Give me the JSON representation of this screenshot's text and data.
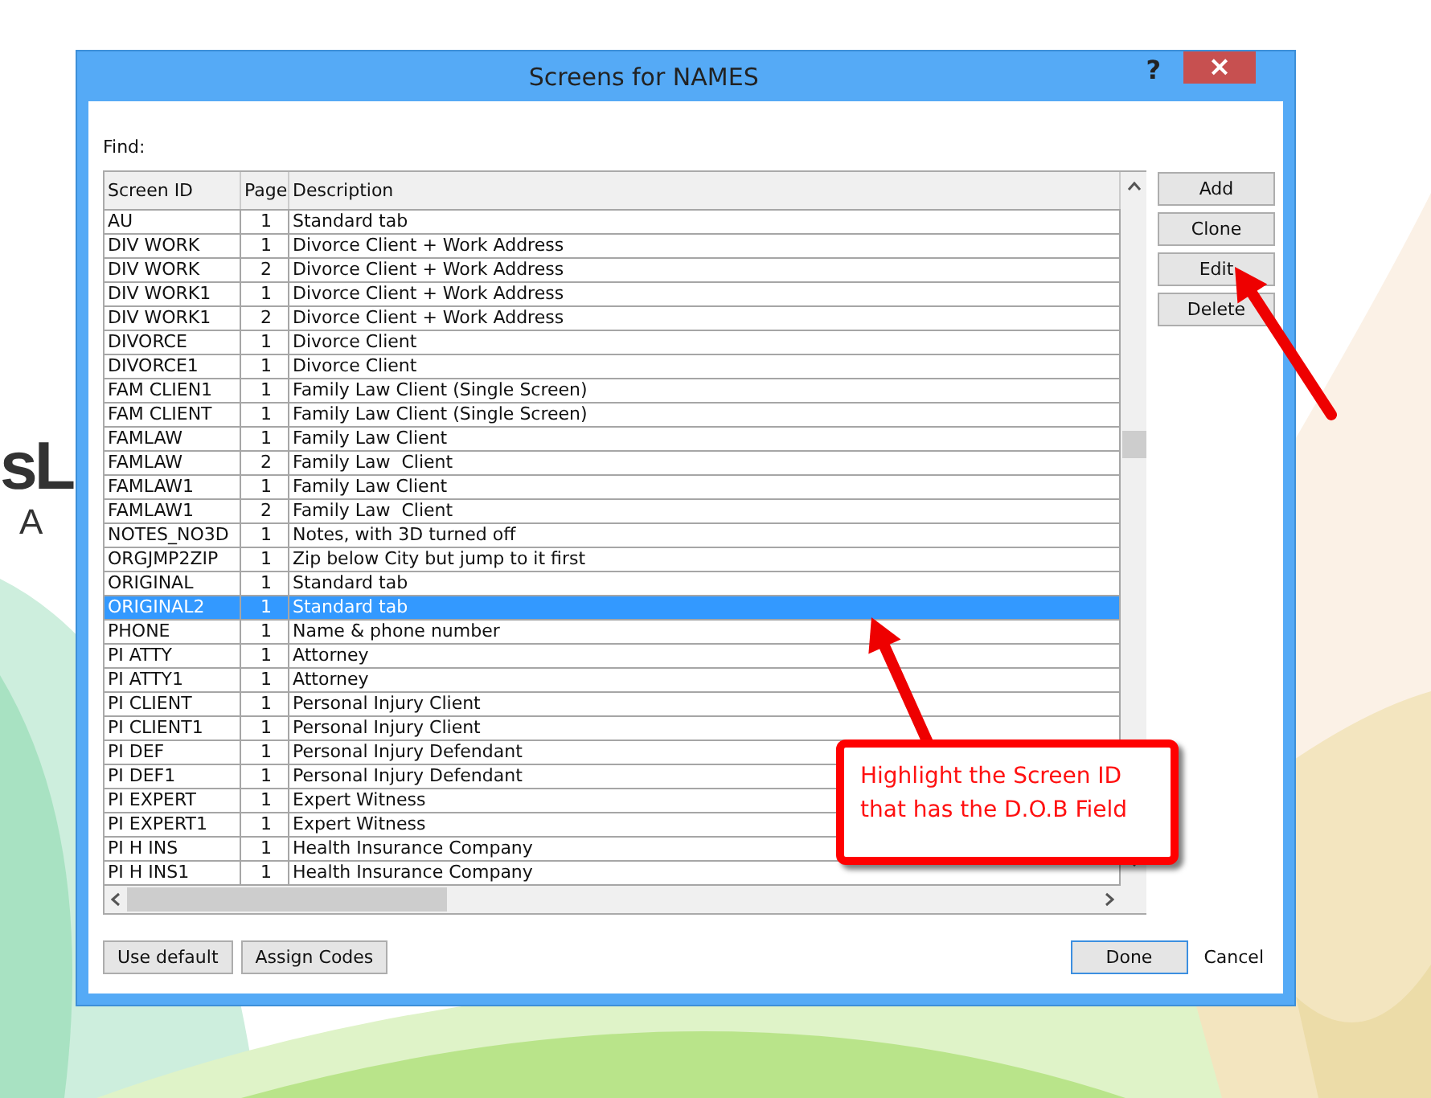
{
  "desktop": {
    "logo_texts": [
      "sL",
      "A"
    ]
  },
  "window": {
    "title": "Screens for NAMES",
    "help": "?",
    "close": "×"
  },
  "find_label": "Find:",
  "table": {
    "columns": [
      "Screen ID",
      "Page",
      "Description"
    ],
    "rows": [
      {
        "cells": [
          "AU",
          "1",
          "Standard tab"
        ],
        "selected": false
      },
      {
        "cells": [
          "DIV WORK",
          "1",
          "Divorce Client + Work Address"
        ],
        "selected": false
      },
      {
        "cells": [
          "DIV WORK",
          "2",
          "Divorce Client + Work Address"
        ],
        "selected": false
      },
      {
        "cells": [
          "DIV WORK1",
          "1",
          "Divorce Client + Work Address"
        ],
        "selected": false
      },
      {
        "cells": [
          "DIV WORK1",
          "2",
          "Divorce Client + Work Address"
        ],
        "selected": false
      },
      {
        "cells": [
          "DIVORCE",
          "1",
          "Divorce Client"
        ],
        "selected": false
      },
      {
        "cells": [
          "DIVORCE1",
          "1",
          "Divorce Client"
        ],
        "selected": false
      },
      {
        "cells": [
          "FAM CLIEN1",
          "1",
          "Family Law Client (Single Screen)"
        ],
        "selected": false
      },
      {
        "cells": [
          "FAM CLIENT",
          "1",
          "Family Law Client (Single Screen)"
        ],
        "selected": false
      },
      {
        "cells": [
          "FAMLAW",
          "1",
          "Family Law Client"
        ],
        "selected": false
      },
      {
        "cells": [
          "FAMLAW",
          "2",
          "Family Law  Client"
        ],
        "selected": false
      },
      {
        "cells": [
          "FAMLAW1",
          "1",
          "Family Law Client"
        ],
        "selected": false
      },
      {
        "cells": [
          "FAMLAW1",
          "2",
          "Family Law  Client"
        ],
        "selected": false
      },
      {
        "cells": [
          "NOTES_NO3D",
          "1",
          "Notes, with 3D turned off"
        ],
        "selected": false
      },
      {
        "cells": [
          "ORGJMP2ZIP",
          "1",
          "Zip below City but jump to it first"
        ],
        "selected": false
      },
      {
        "cells": [
          "ORIGINAL",
          "1",
          "Standard tab"
        ],
        "selected": false
      },
      {
        "cells": [
          "ORIGINAL2",
          "1",
          "Standard tab"
        ],
        "selected": true
      },
      {
        "cells": [
          "PHONE",
          "1",
          "Name & phone number"
        ],
        "selected": false
      },
      {
        "cells": [
          "PI ATTY",
          "1",
          "Attorney"
        ],
        "selected": false
      },
      {
        "cells": [
          "PI ATTY1",
          "1",
          "Attorney"
        ],
        "selected": false
      },
      {
        "cells": [
          "PI CLIENT",
          "1",
          "Personal Injury Client"
        ],
        "selected": false
      },
      {
        "cells": [
          "PI CLIENT1",
          "1",
          "Personal Injury Client"
        ],
        "selected": false
      },
      {
        "cells": [
          "PI DEF",
          "1",
          "Personal Injury Defendant"
        ],
        "selected": false
      },
      {
        "cells": [
          "PI DEF1",
          "1",
          "Personal Injury Defendant"
        ],
        "selected": false
      },
      {
        "cells": [
          "PI EXPERT",
          "1",
          "Expert Witness"
        ],
        "selected": false
      },
      {
        "cells": [
          "PI EXPERT1",
          "1",
          "Expert Witness"
        ],
        "selected": false
      },
      {
        "cells": [
          "PI H INS",
          "1",
          "Health Insurance Company"
        ],
        "selected": false
      },
      {
        "cells": [
          "PI H INS1",
          "1",
          "Health Insurance Company"
        ],
        "selected": false
      }
    ]
  },
  "side_buttons": [
    "Add",
    "Clone",
    "Edit",
    "Delete"
  ],
  "footer_buttons": [
    "Use default",
    "Assign Codes"
  ],
  "done": "Done",
  "cancel": "Cancel",
  "arrows": [
    {
      "kind": "arrow"
    },
    {
      "kind": "arrow"
    }
  ],
  "callout": {
    "text": "Highlight the Screen ID that has the D.O.B Field"
  }
}
